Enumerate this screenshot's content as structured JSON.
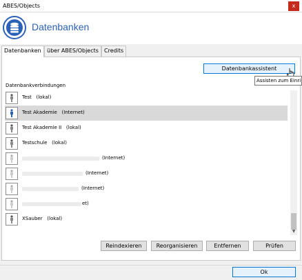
{
  "window": {
    "title": "ABES/Objects",
    "close_glyph": "x"
  },
  "header": {
    "title": "Datenbanken",
    "logo_icon": "database-icon",
    "accent": "#2b62b7"
  },
  "tabs": [
    {
      "label": "Datenbanken",
      "active": true
    },
    {
      "label": "über ABES/Objects",
      "active": false
    },
    {
      "label": "Credits",
      "active": false
    }
  ],
  "wizard_button": "Datenbankassistent",
  "tooltip": "Assisten zum Einri",
  "section_label": "Datenbankverbindungen",
  "connections": [
    {
      "name": "Test",
      "type": "(lokal)",
      "selected": false
    },
    {
      "name": "Test Akademie",
      "type": "(Internet)",
      "selected": true
    },
    {
      "name": "Test Akademie II",
      "type": "(lokal)",
      "selected": false
    },
    {
      "name": "Testschule",
      "type": "(lokal)",
      "selected": false
    },
    {
      "name": "",
      "type": "(Internet)",
      "selected": false
    },
    {
      "name": "",
      "type": "(Internet)",
      "selected": false
    },
    {
      "name": "",
      "type": "(Internet)",
      "selected": false
    },
    {
      "name": "",
      "type": "et)",
      "selected": false
    },
    {
      "name": "XSauber",
      "type": "(lokal)",
      "selected": false
    }
  ],
  "actions": {
    "reindex": "Reindexieren",
    "reorganize": "Reorganisieren",
    "remove": "Entfernen",
    "check": "Prüfen"
  },
  "ok_button": "Ok",
  "colors": {
    "selection": "#d9d9d9",
    "close": "#c42b1c"
  }
}
